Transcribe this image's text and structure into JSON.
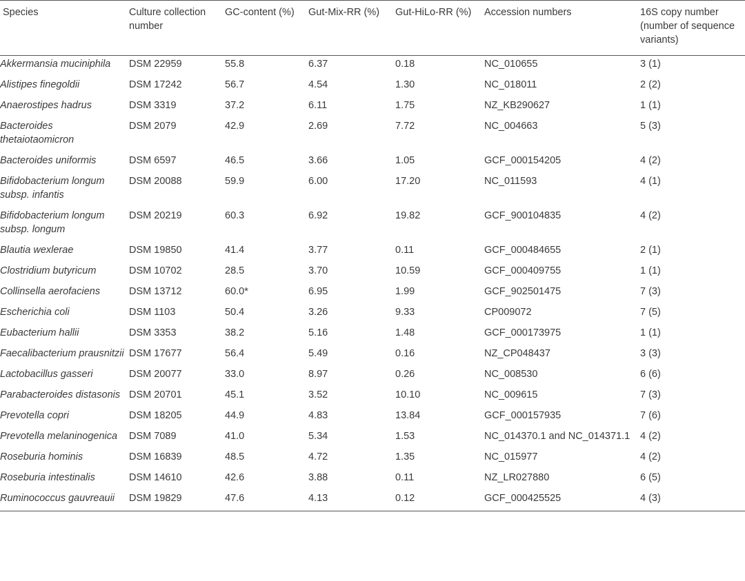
{
  "table": {
    "headers": [
      "Species",
      "Culture collection number",
      "GC-content (%)",
      "Gut-Mix-RR (%)",
      "Gut-HiLo-RR (%)",
      "Accession numbers",
      "16S copy number (number of sequence variants)"
    ],
    "rows": [
      {
        "species": "Akkermansia muciniphila",
        "dsm": "DSM 22959",
        "gc": "55.8",
        "mix": "6.37",
        "hilo": "0.18",
        "acc": "NC_010655",
        "copy": "3 (1)"
      },
      {
        "species": "Alistipes finegoldii",
        "dsm": "DSM 17242",
        "gc": "56.7",
        "mix": "4.54",
        "hilo": "1.30",
        "acc": "NC_018011",
        "copy": "2 (2)"
      },
      {
        "species": "Anaerostipes hadrus",
        "dsm": "DSM 3319",
        "gc": "37.2",
        "mix": "6.11",
        "hilo": "1.75",
        "acc": "NZ_KB290627",
        "copy": "1 (1)"
      },
      {
        "species": "Bacteroides thetaiotaomicron",
        "dsm": "DSM 2079",
        "gc": "42.9",
        "mix": "2.69",
        "hilo": "7.72",
        "acc": "NC_004663",
        "copy": "5 (3)"
      },
      {
        "species": "Bacteroides uniformis",
        "dsm": "DSM 6597",
        "gc": "46.5",
        "mix": "3.66",
        "hilo": "1.05",
        "acc": "GCF_000154205",
        "copy": "4 (2)"
      },
      {
        "species": "Bifidobacterium longum subsp. infantis",
        "dsm": "DSM 20088",
        "gc": "59.9",
        "mix": "6.00",
        "hilo": "17.20",
        "acc": "NC_011593",
        "copy": "4 (1)"
      },
      {
        "species": "Bifidobacterium longum subsp. longum",
        "dsm": "DSM 20219",
        "gc": "60.3",
        "mix": "6.92",
        "hilo": "19.82",
        "acc": "GCF_900104835",
        "copy": "4 (2)"
      },
      {
        "species": "Blautia wexlerae",
        "dsm": "DSM 19850",
        "gc": "41.4",
        "mix": "3.77",
        "hilo": "0.11",
        "acc": "GCF_000484655",
        "copy": "2 (1)"
      },
      {
        "species": "Clostridium butyricum",
        "dsm": "DSM 10702",
        "gc": "28.5",
        "mix": "3.70",
        "hilo": "10.59",
        "acc": "GCF_000409755",
        "copy": "1 (1)"
      },
      {
        "species": "Collinsella aerofaciens",
        "dsm": "DSM 13712",
        "gc": "60.0*",
        "mix": "6.95",
        "hilo": "1.99",
        "acc": "GCF_902501475",
        "copy": "7 (3)"
      },
      {
        "species": "Escherichia coli",
        "dsm": "DSM 1103",
        "gc": "50.4",
        "mix": "3.26",
        "hilo": "9.33",
        "acc": "CP009072",
        "copy": "7 (5)"
      },
      {
        "species": "Eubacterium hallii",
        "dsm": "DSM 3353",
        "gc": "38.2",
        "mix": "5.16",
        "hilo": "1.48",
        "acc": "GCF_000173975",
        "copy": "1 (1)"
      },
      {
        "species": "Faecalibacterium prausnitzii",
        "dsm": "DSM 17677",
        "gc": "56.4",
        "mix": "5.49",
        "hilo": "0.16",
        "acc": "NZ_CP048437",
        "copy": "3 (3)"
      },
      {
        "species": "Lactobacillus gasseri",
        "dsm": "DSM 20077",
        "gc": "33.0",
        "mix": "8.97",
        "hilo": "0.26",
        "acc": "NC_008530",
        "copy": "6 (6)"
      },
      {
        "species": "Parabacteroides distasonis",
        "dsm": "DSM 20701",
        "gc": "45.1",
        "mix": "3.52",
        "hilo": "10.10",
        "acc": "NC_009615",
        "copy": "7 (3)"
      },
      {
        "species": "Prevotella copri",
        "dsm": "DSM 18205",
        "gc": "44.9",
        "mix": "4.83",
        "hilo": "13.84",
        "acc": "GCF_000157935",
        "copy": "7 (6)"
      },
      {
        "species": "Prevotella melaninogenica",
        "dsm": "DSM 7089",
        "gc": "41.0",
        "mix": "5.34",
        "hilo": "1.53",
        "acc": "NC_014370.1 and NC_014371.1",
        "copy": "4 (2)"
      },
      {
        "species": "Roseburia hominis",
        "dsm": "DSM 16839",
        "gc": "48.5",
        "mix": "4.72",
        "hilo": "1.35",
        "acc": "NC_015977",
        "copy": "4 (2)"
      },
      {
        "species": "Roseburia intestinalis",
        "dsm": "DSM 14610",
        "gc": "42.6",
        "mix": "3.88",
        "hilo": "0.11",
        "acc": "NZ_LR027880",
        "copy": "6 (5)"
      },
      {
        "species": "Ruminococcus gauvreauii",
        "dsm": "DSM 19829",
        "gc": "47.6",
        "mix": "4.13",
        "hilo": "0.12",
        "acc": "GCF_000425525",
        "copy": "4 (3)"
      }
    ]
  }
}
